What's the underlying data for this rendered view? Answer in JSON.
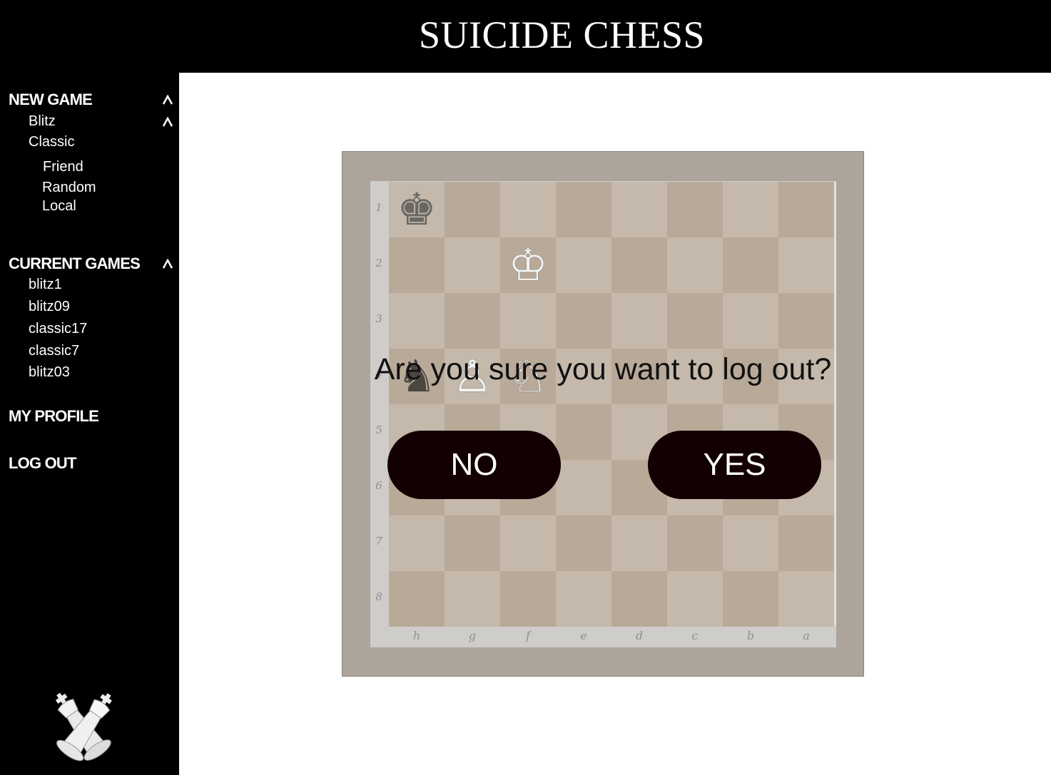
{
  "app": {
    "title": "SUICIDE CHESS"
  },
  "sidebar": {
    "new_game": {
      "label": "NEW GAME",
      "blitz": "Blitz",
      "classic": "Classic",
      "sub": [
        "Friend",
        "Random",
        "Local"
      ]
    },
    "current_games": {
      "label": "CURRENT GAMES",
      "games": [
        "blitz1",
        "blitz09",
        "classic17",
        "classic7",
        "blitz03"
      ]
    },
    "my_profile": "MY PROFILE",
    "log_out": "LOG OUT",
    "logo_icon": "crossed-kings-icon"
  },
  "board": {
    "ranks": [
      "1",
      "2",
      "3",
      "4",
      "5",
      "6",
      "7",
      "8"
    ],
    "files": [
      "h",
      "g",
      "f",
      "e",
      "d",
      "c",
      "b",
      "a"
    ],
    "pieces": [
      {
        "square": "h1",
        "piece": "black-king-icon"
      },
      {
        "square": "f2",
        "piece": "white-king-icon"
      },
      {
        "square": "h4",
        "piece": "black-knight-icon"
      },
      {
        "square": "g4",
        "piece": "white-pawn-icon"
      },
      {
        "square": "f4",
        "piece": "white-knight-icon"
      }
    ],
    "colors": {
      "light": "#c4b9ab",
      "dark": "#b9a998",
      "frame": "#ada59b"
    }
  },
  "dialog": {
    "question": "Are you sure you want to log out?",
    "no_label": "NO",
    "yes_label": "YES",
    "button_color": "#130002"
  }
}
